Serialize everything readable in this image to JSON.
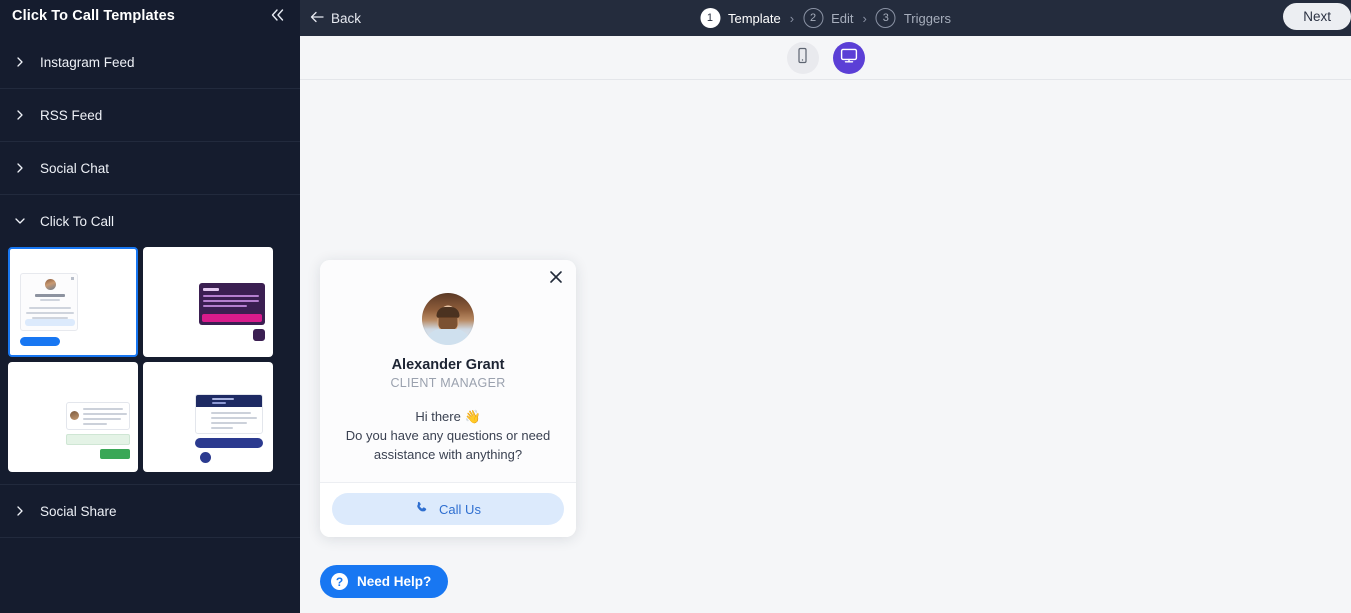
{
  "sidebar": {
    "title": "Click To Call Templates",
    "collapse_icon": "chevron-double-left-icon",
    "sections": [
      {
        "label": "Instagram Feed",
        "expanded": false,
        "icon": "chevron-right-icon"
      },
      {
        "label": "RSS Feed",
        "expanded": false,
        "icon": "chevron-right-icon"
      },
      {
        "label": "Social Chat",
        "expanded": false,
        "icon": "chevron-right-icon"
      },
      {
        "label": "Click To Call",
        "expanded": true,
        "icon": "chevron-down-icon"
      },
      {
        "label": "Social Share",
        "expanded": false,
        "icon": "chevron-right-icon"
      }
    ],
    "templates": [
      {
        "name": "template-1",
        "selected": true,
        "theme": "#1877f2"
      },
      {
        "name": "template-2",
        "selected": false,
        "theme": "#d81b8c"
      },
      {
        "name": "template-3",
        "selected": false,
        "theme": "#3aa757"
      },
      {
        "name": "template-4",
        "selected": false,
        "theme": "#2b3a8f"
      }
    ]
  },
  "topbar": {
    "back_label": "Back",
    "back_icon": "arrow-left-icon",
    "next_label": "Next",
    "steps": [
      {
        "num": "1",
        "label": "Template",
        "active": true
      },
      {
        "num": "2",
        "label": "Edit",
        "active": false
      },
      {
        "num": "3",
        "label": "Triggers",
        "active": false
      }
    ],
    "separator": "›"
  },
  "device_toggle": {
    "mobile": {
      "icon": "mobile-icon",
      "active": false
    },
    "desktop": {
      "icon": "desktop-monitor-icon",
      "active": true
    }
  },
  "widget": {
    "close_icon": "close-x-icon",
    "avatar_icon": "user-avatar-photo",
    "name": "Alexander Grant",
    "role": "CLIENT MANAGER",
    "greeting": "Hi there 👋",
    "message": "Do you have any questions or need assistance with anything?",
    "call_button": {
      "label": "Call Us",
      "icon": "phone-icon"
    }
  },
  "need_help": {
    "label": "Need Help?",
    "icon": "question-mark-circle-icon"
  },
  "colors": {
    "sidebar_bg": "#151c2e",
    "topbar_bg": "#242c3d",
    "canvas_bg": "#f5f6f8",
    "accent_blue": "#1877f2",
    "accent_purple": "#5b3fd6",
    "call_btn_bg": "#dceafc",
    "call_btn_text": "#2f6fd0"
  }
}
